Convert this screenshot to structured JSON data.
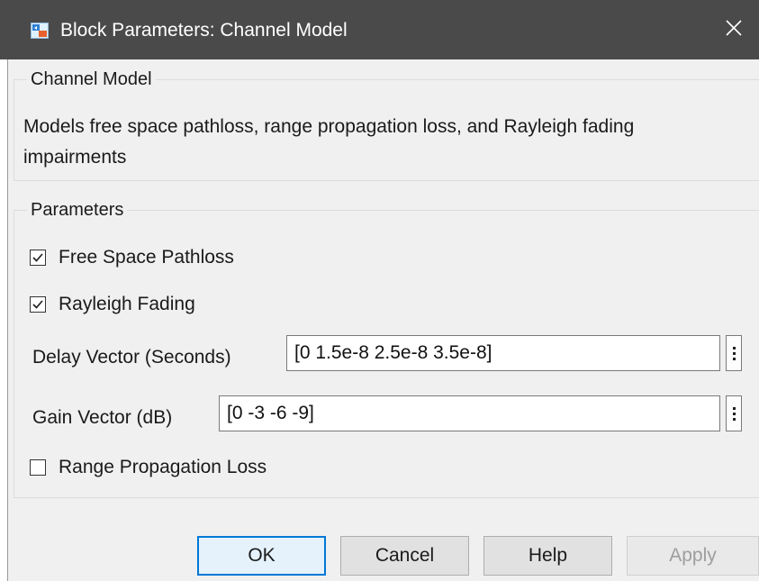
{
  "window": {
    "title": "Block Parameters: Channel Model",
    "close_glyph": "✕"
  },
  "description_group": {
    "legend": "Channel Model",
    "text": "Models free space pathloss, range propagation loss, and Rayleigh fading impairments"
  },
  "parameters": {
    "legend": "Parameters",
    "free_space_pathloss": {
      "label": "Free Space Pathloss",
      "checked": true
    },
    "rayleigh_fading": {
      "label": "Rayleigh Fading",
      "checked": true
    },
    "delay_vector": {
      "label": "Delay Vector (Seconds)",
      "value": "[0 1.5e-8 2.5e-8 3.5e-8]"
    },
    "gain_vector": {
      "label": "Gain Vector (dB)",
      "value": "[0 -3 -6 -9]"
    },
    "range_propagation_loss": {
      "label": "Range Propagation Loss",
      "checked": false
    }
  },
  "buttons": {
    "ok": "OK",
    "cancel": "Cancel",
    "help": "Help",
    "apply": "Apply"
  },
  "colors": {
    "titlebar": "#4a4a4a",
    "focus_accent": "#0078d7",
    "dialog_bg": "#f0f0f0"
  },
  "icons": {
    "app": "simulink-block-icon",
    "close": "close-icon",
    "check": "checkmark-icon",
    "field_menu": "vertical-ellipsis-icon"
  }
}
